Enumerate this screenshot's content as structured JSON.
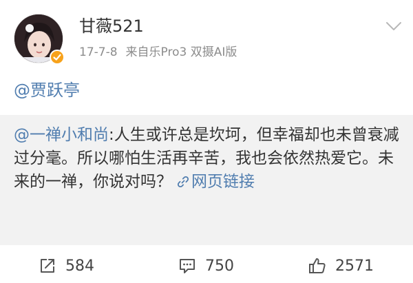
{
  "post": {
    "username": "甘薇521",
    "date": "17-7-8",
    "source": "来自乐Pro3 双摄AI版",
    "mention": "@贾跃亭"
  },
  "repost": {
    "author": "@一禅小和尚",
    "text": ":人生或许总是坎坷，但幸福却也未曾衰减过分毫。所以哪怕生活再辛苦，我也会依然热爱它。未来的一禅，你说对吗？",
    "link_label": "网页链接"
  },
  "actions": {
    "reposts": "584",
    "comments": "750",
    "likes": "2571"
  },
  "icons": {
    "menu": "chevron-down-icon",
    "verified": "verified-badge-icon",
    "link": "link-icon",
    "repost": "repost-icon",
    "comment": "comment-icon",
    "like": "thumbs-up-icon"
  },
  "colors": {
    "link_blue": "#507daf",
    "verified_orange": "#f7a21b",
    "repost_bg": "#f2f2f2"
  }
}
